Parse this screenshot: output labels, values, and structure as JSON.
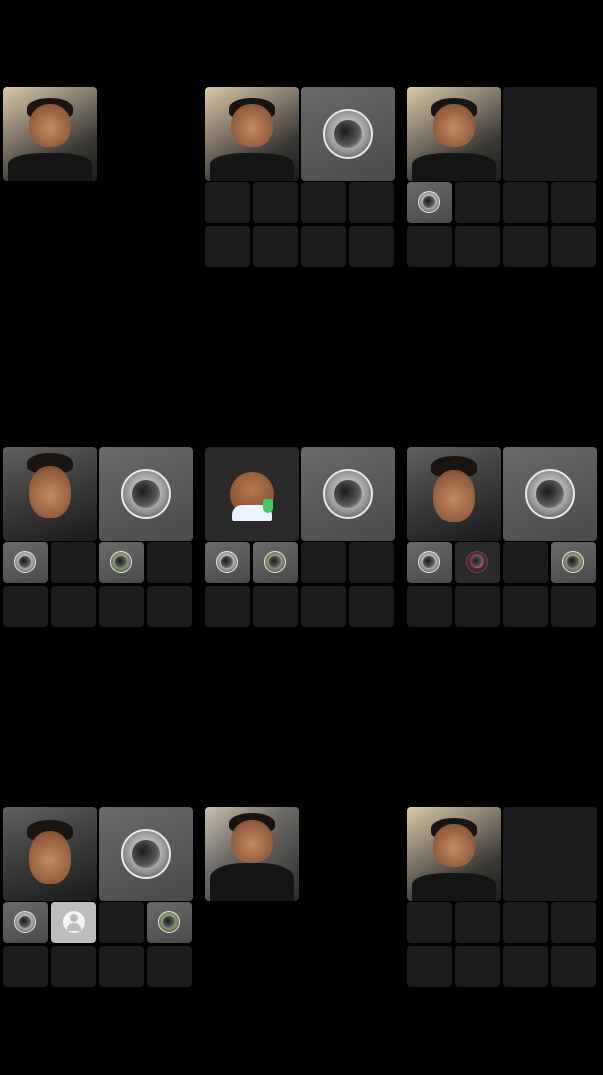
{
  "screen": {
    "description_panels": 9
  },
  "panels": [
    {
      "id": "p1",
      "tiles": [
        "video"
      ]
    },
    {
      "id": "p2",
      "tiles": [
        "video",
        "avatar"
      ]
    },
    {
      "id": "p3",
      "tiles": [
        "video",
        "avatar-small"
      ]
    },
    {
      "id": "p4",
      "tiles": [
        "video",
        "avatar",
        "avatar-small",
        "avatar-small-green"
      ]
    },
    {
      "id": "p5",
      "tiles": [
        "emoji-avatar",
        "avatar",
        "avatar-small",
        "avatar-small-green"
      ]
    },
    {
      "id": "p6",
      "tiles": [
        "video",
        "avatar",
        "avatar-small",
        "avatar-small-pink",
        "avatar-small-green"
      ]
    },
    {
      "id": "p7",
      "tiles": [
        "video",
        "avatar",
        "avatar-small",
        "generic-user",
        "avatar-small-green"
      ]
    },
    {
      "id": "p8",
      "tiles": [
        "video"
      ]
    },
    {
      "id": "p9",
      "tiles": [
        "video"
      ]
    }
  ]
}
